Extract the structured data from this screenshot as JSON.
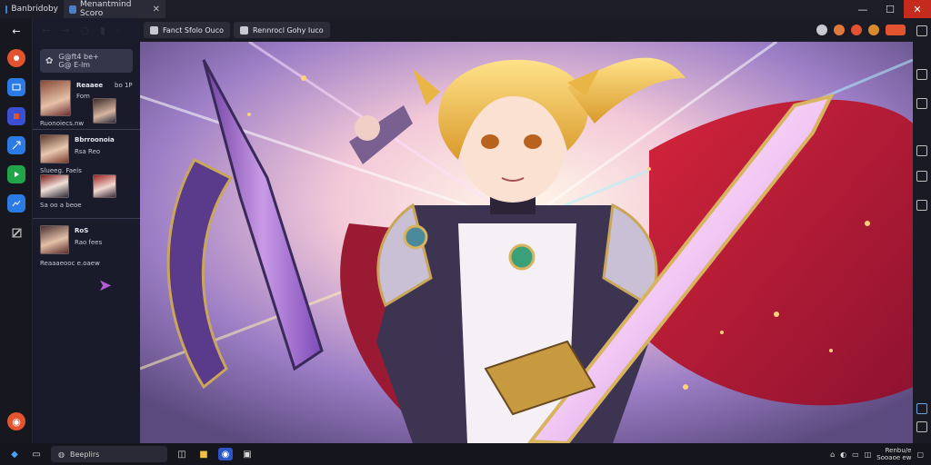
{
  "window": {
    "app_title": "Banbridoby",
    "active_tab_title": "Menantmind Scoro",
    "minimize_glyph": "—",
    "maximize_glyph": "☐",
    "close_glyph": "✕",
    "tab_close_glyph": "✕"
  },
  "nav": {
    "back": "←",
    "forward": "→",
    "reload": "○",
    "bookmark": "▮",
    "more": "›"
  },
  "toolbar": {
    "tab1_label": "Fanct Sfolo Ouco",
    "tab2_label": "Rennrocl Gohy Iuco"
  },
  "sidebar": {
    "search_text": "G@ft4 be+",
    "search_sub": "G@ E-lm",
    "items": [
      {
        "title": "Reaaee",
        "subtitle": "bo 1P",
        "extra": "Fom"
      },
      {
        "caption": "Ruonoiecs.nw"
      },
      {
        "title": "Bbrroonoia",
        "subtitle": "Rsa Reo"
      },
      {
        "caption": "Slueeg. Faeis"
      },
      {
        "caption": "Sa oo a beoe"
      },
      {
        "title": "RoS",
        "subtitle": "Rao fees"
      },
      {
        "caption": "Reaaaeooc e.oaew"
      }
    ]
  },
  "taskbar": {
    "search_label": "Beeplirs",
    "clock_time": "Renbu/e",
    "clock_date": "Sooaoe ew"
  },
  "colors": {
    "accent_orange": "#e2532f",
    "close_red": "#c42b1c",
    "rail_blue": "#2c7be5",
    "rail_green": "#20a54a"
  },
  "icons": {
    "rail": [
      "back-arrow-icon",
      "home-icon",
      "news-icon",
      "media-icon",
      "share-icon",
      "play-icon",
      "image-icon",
      "edit-icon"
    ],
    "right_rail": [
      "share-icon",
      "bookmark-icon",
      "chat-icon",
      "settings-icon"
    ]
  }
}
